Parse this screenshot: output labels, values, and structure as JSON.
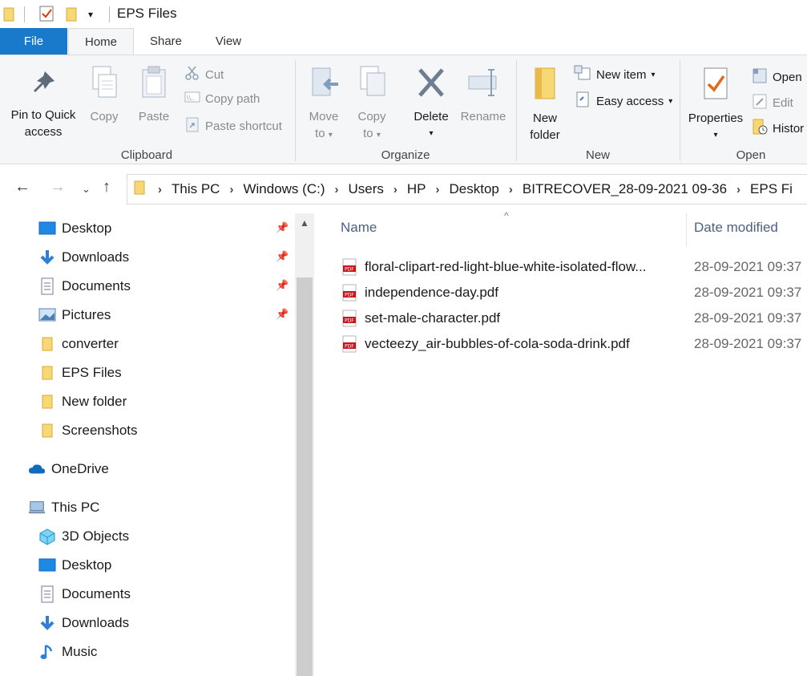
{
  "window": {
    "title": "EPS Files",
    "dropdown_glyph": "▾"
  },
  "quick_access_toolbar": {
    "icons": [
      "folder-icon",
      "properties-icon",
      "new-folder-icon",
      "customize-dropdown-icon"
    ]
  },
  "tabs": {
    "file": "File",
    "home": "Home",
    "share": "Share",
    "view": "View"
  },
  "ribbon": {
    "clipboard": {
      "label": "Clipboard",
      "pin_line1": "Pin to Quick",
      "pin_line2": "access",
      "copy": "Copy",
      "paste": "Paste",
      "cut": "Cut",
      "copy_path": "Copy path",
      "paste_shortcut": "Paste shortcut"
    },
    "organize": {
      "label": "Organize",
      "move_line1": "Move",
      "move_line2": "to",
      "copy_line1": "Copy",
      "copy_line2": "to",
      "delete": "Delete",
      "rename": "Rename"
    },
    "new": {
      "label": "New",
      "new_folder_line1": "New",
      "new_folder_line2": "folder",
      "new_item": "New item",
      "easy_access": "Easy access"
    },
    "open": {
      "label": "Open",
      "properties": "Properties",
      "open": "Open",
      "edit": "Edit",
      "history": "Histor"
    }
  },
  "address": {
    "crumbs": [
      "This PC",
      "Windows (C:)",
      "Users",
      "HP",
      "Desktop",
      "BITRECOVER_28-09-2021 09-36",
      "EPS Fi"
    ],
    "separator": "›"
  },
  "nav": {
    "quick_access": [
      {
        "label": "Desktop",
        "pinned": true,
        "icon": "desktop-icon"
      },
      {
        "label": "Downloads",
        "pinned": true,
        "icon": "downloads-icon"
      },
      {
        "label": "Documents",
        "pinned": true,
        "icon": "documents-icon"
      },
      {
        "label": "Pictures",
        "pinned": true,
        "icon": "pictures-icon"
      },
      {
        "label": "converter",
        "pinned": false,
        "icon": "folder-icon"
      },
      {
        "label": "EPS Files",
        "pinned": false,
        "icon": "folder-icon"
      },
      {
        "label": "New folder",
        "pinned": false,
        "icon": "folder-icon"
      },
      {
        "label": "Screenshots",
        "pinned": false,
        "icon": "folder-icon"
      }
    ],
    "onedrive": "OneDrive",
    "this_pc": "This PC",
    "this_pc_items": [
      {
        "label": "3D Objects",
        "icon": "3d-objects-icon"
      },
      {
        "label": "Desktop",
        "icon": "desktop-icon"
      },
      {
        "label": "Documents",
        "icon": "documents-icon"
      },
      {
        "label": "Downloads",
        "icon": "downloads-icon"
      },
      {
        "label": "Music",
        "icon": "music-icon"
      }
    ]
  },
  "columns": {
    "name": "Name",
    "date_modified": "Date modified",
    "sort_glyph": "^"
  },
  "files": [
    {
      "name": "floral-clipart-red-light-blue-white-isolated-flow...",
      "date": "28-09-2021 09:37"
    },
    {
      "name": "independence-day.pdf",
      "date": "28-09-2021 09:37"
    },
    {
      "name": "set-male-character.pdf",
      "date": "28-09-2021 09:37"
    },
    {
      "name": "vecteezy_air-bubbles-of-cola-soda-drink.pdf",
      "date": "28-09-2021 09:37"
    }
  ],
  "colors": {
    "file_tab": "#1979ca",
    "folder_yellow": "#f8d775",
    "pdf_red": "#c4161c",
    "header_text": "#4d6082"
  }
}
